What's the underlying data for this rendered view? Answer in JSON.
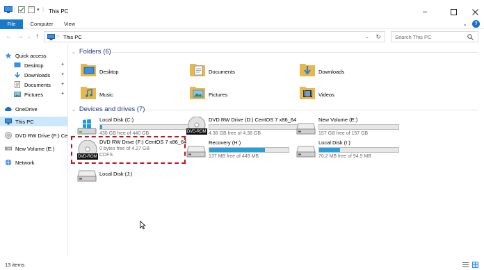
{
  "window": {
    "title": "This PC"
  },
  "ribbon": {
    "tabs": [
      "File",
      "Computer",
      "View"
    ]
  },
  "address": {
    "path": "This PC",
    "search_placeholder": "Search This PC"
  },
  "sidebar": {
    "items": [
      {
        "label": "Quick access",
        "icon": "star-icon"
      },
      {
        "label": "Desktop",
        "icon": "desktop-folder-icon"
      },
      {
        "label": "Downloads",
        "icon": "downloads-folder-icon"
      },
      {
        "label": "Documents",
        "icon": "documents-folder-icon"
      },
      {
        "label": "Pictures",
        "icon": "pictures-folder-icon"
      },
      {
        "label": "OneDrive",
        "icon": "cloud-icon"
      },
      {
        "label": "This PC",
        "icon": "computer-icon"
      },
      {
        "label": "DVD RW Drive (F:) Ce",
        "icon": "dvd-icon"
      },
      {
        "label": "New Volume (E:)",
        "icon": "drive-icon"
      },
      {
        "label": "Network",
        "icon": "network-icon"
      }
    ]
  },
  "folders": {
    "header": "Folders (6)",
    "items": [
      "Desktop",
      "Documents",
      "Downloads",
      "Music",
      "Pictures",
      "Videos"
    ]
  },
  "drives": {
    "header": "Devices and drives (7)",
    "items": [
      {
        "name": "Local Disk (C:)",
        "free": "430 GB free of 440 GB",
        "fill": 0.02
      },
      {
        "name": "DVD RW Drive (D:) CentOS 7 x86_64",
        "free": "4.38 GB free of 4.38 GB",
        "fill": 0.0,
        "badge": "DVD-ROM"
      },
      {
        "name": "New Volume (E:)",
        "free": "157 GB free of 157 GB",
        "fill": 0.0
      },
      {
        "name": "DVD RW Drive (F:) CentOS 7 x86_64",
        "free": "0 bytes free of 4.27 GB",
        "fs": "CDFS",
        "badge": "DVD-ROM"
      },
      {
        "name": "Recovery (H:)",
        "free": "137 MB free of 449 MB",
        "fill": 0.7
      },
      {
        "name": "Local Disk (I:)",
        "free": "70.2 MB free of 94.9 MB",
        "fill": 0.26
      },
      {
        "name": "Local Disk (J:)"
      }
    ]
  },
  "status": {
    "items": "13 items"
  },
  "colors": {
    "accent": "#1979ca",
    "selected": "#cce8ff",
    "bar_fill": "#26a0da",
    "highlight": "#c0141c",
    "header": "#1e3287"
  }
}
